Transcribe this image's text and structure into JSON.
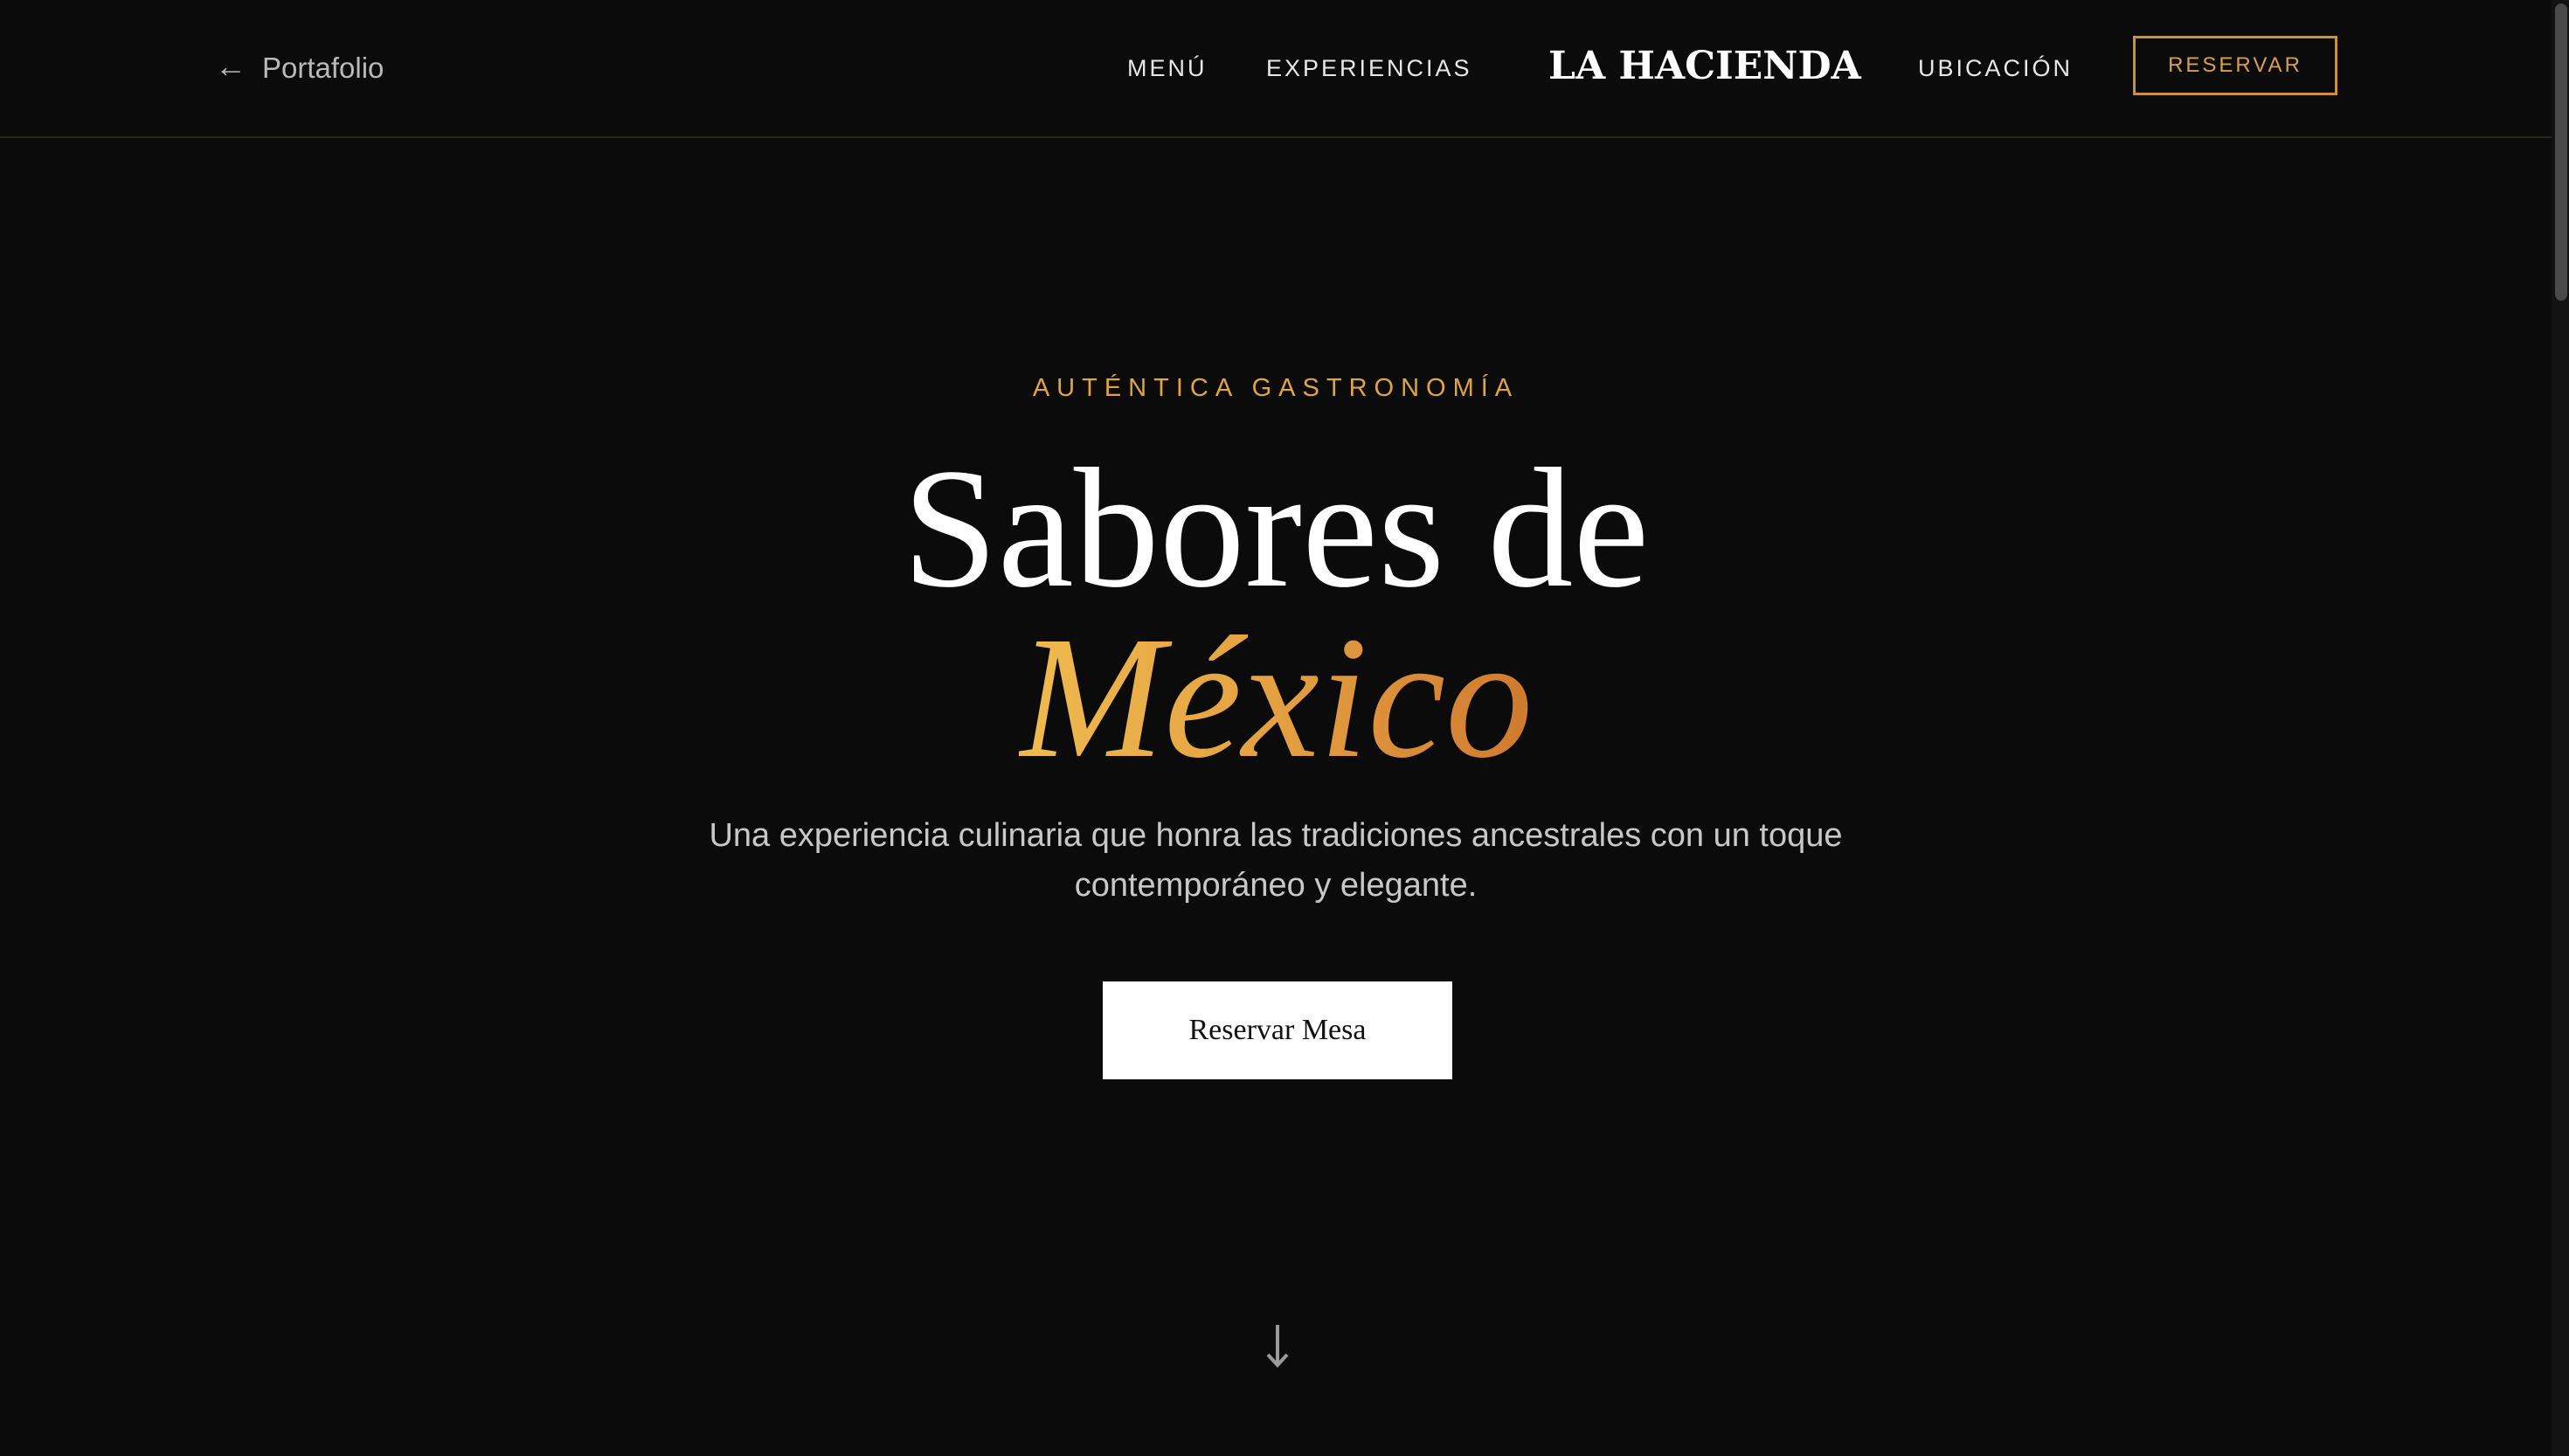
{
  "header": {
    "back_label": "Portafolio",
    "nav": {
      "menu": "MENÚ",
      "experiences": "EXPERIENCIAS",
      "location": "UBICACIÓN"
    },
    "brand": "LA HACIENDA",
    "reserve_label": "RESERVAR"
  },
  "hero": {
    "eyebrow": "AUTÉNTICA GASTRONOMÍA",
    "title_line1": "Sabores de",
    "title_line2": "México",
    "subtitle_line1": "Una experiencia culinaria que honra las tradiciones ancestrales con un toque",
    "subtitle_line2": "contemporáneo y elegante.",
    "cta_label": "Reservar Mesa"
  },
  "icons": {
    "back": "arrow-left-icon",
    "scroll": "arrow-down-icon"
  },
  "colors": {
    "background": "#0b0b0b",
    "accent": "#e0a53f",
    "accent_end": "#cf7a2e",
    "text": "#ffffff",
    "muted": "#c8c8c8"
  }
}
